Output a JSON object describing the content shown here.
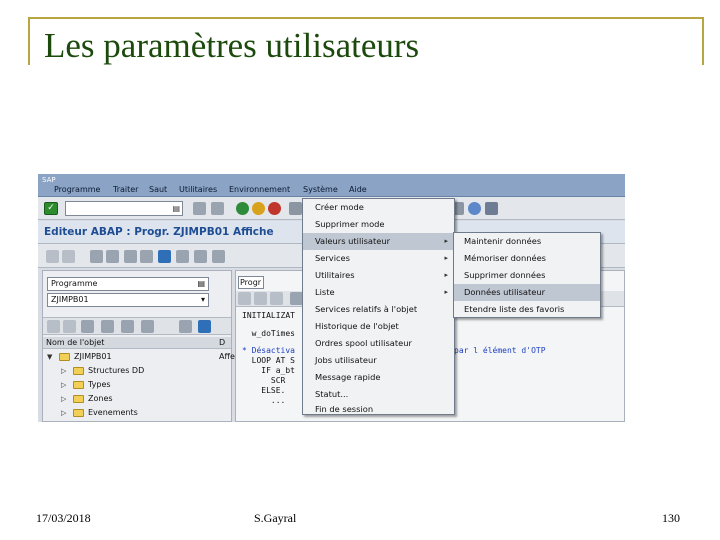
{
  "slide": {
    "title": "Les paramètres utilisateurs",
    "footer_date": "17/03/2018",
    "footer_author": "S.Gayral",
    "footer_page": "130"
  },
  "sap": {
    "logo": "SAP",
    "menubar": [
      "Programme",
      "Traiter",
      "Saut",
      "Utilitaires",
      "Environnement",
      "Système",
      "Aide"
    ],
    "window_title": "Editeur ABAP : Progr. ZJIMPB01 Affiche",
    "left_panel": {
      "object_type": "Programme",
      "object_name": "ZJIMPB01",
      "tree_header": "Nom de l'objet",
      "tree_header_col2": "D",
      "tree": [
        {
          "label": "ZJIMPB01",
          "extra": "Affe"
        },
        {
          "label": "Structures DD",
          "extra": ""
        },
        {
          "label": "Types",
          "extra": ""
        },
        {
          "label": "Zones",
          "extra": ""
        },
        {
          "label": "Evenements",
          "extra": ""
        }
      ]
    },
    "editor": {
      "field_label": "Progr",
      "lines": [
        {
          "text": "INITIALIZAT",
          "blue": false
        },
        {
          "text": "  w_doTimes",
          "blue": false
        },
        {
          "text": "* Désactiva",
          "blue": true
        },
        {
          "text": "  LOOP AT S",
          "blue": false
        },
        {
          "text": "    IF a_bt",
          "blue": false
        },
        {
          "text": "      SCR",
          "blue": false
        },
        {
          "text": "    ELSE.",
          "blue": false
        },
        {
          "text": "      ...",
          "blue": false
        }
      ],
      "overlay_text": "par l élément d'OTP"
    },
    "system_menu": [
      {
        "label": "Créer mode",
        "submenu": false
      },
      {
        "label": "Supprimer mode",
        "submenu": false
      },
      {
        "label": "Valeurs utilisateur",
        "submenu": true,
        "highlighted": true
      },
      {
        "label": "Services",
        "submenu": true
      },
      {
        "label": "Utilitaires",
        "submenu": true
      },
      {
        "label": "Liste",
        "submenu": true
      },
      {
        "label": "Services relatifs à l'objet",
        "submenu": false
      },
      {
        "label": "Historique de l'objet",
        "submenu": false
      },
      {
        "label": "Ordres spool utilisateur",
        "submenu": false
      },
      {
        "label": "Jobs utilisateur",
        "submenu": false
      },
      {
        "label": "Message rapide",
        "submenu": false
      },
      {
        "label": "Statut...",
        "submenu": false
      },
      {
        "label": "Fin de session",
        "submenu": false
      }
    ],
    "user_values_menu": [
      {
        "label": "Maintenir données"
      },
      {
        "label": "Mémoriser données"
      },
      {
        "label": "Supprimer données"
      },
      {
        "label": "Données utilisateur",
        "highlighted": true
      },
      {
        "label": "Etendre liste des favoris"
      }
    ],
    "colors": {
      "menubar": "#8ba3c4",
      "title_text": "#1e4d94",
      "highlight": "#bfc7d2",
      "slide_title": "#1c4a0d",
      "frame": "#b8a642"
    }
  }
}
